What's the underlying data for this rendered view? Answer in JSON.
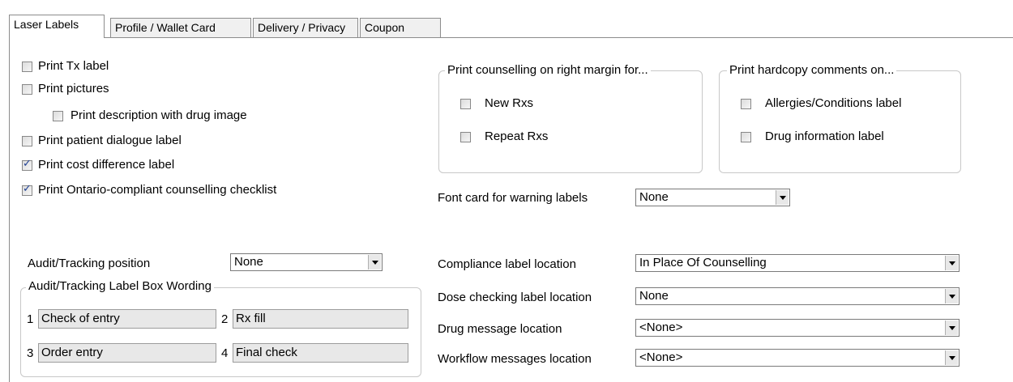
{
  "tabs": [
    {
      "label": "Laser Labels",
      "active": true
    },
    {
      "label": "Profile / Wallet Card"
    },
    {
      "label": "Delivery / Privacy"
    },
    {
      "label": "Coupon"
    }
  ],
  "left_options": [
    {
      "label": "Print Tx label",
      "checked": false
    },
    {
      "label": "Print pictures",
      "checked": false
    },
    {
      "label": "Print description with drug image",
      "checked": false
    },
    {
      "label": "Print patient dialogue label",
      "checked": false
    },
    {
      "label": "Print cost difference label",
      "checked": true
    },
    {
      "label": "Print Ontario-compliant counselling checklist",
      "checked": true
    }
  ],
  "counselling_group": {
    "title": "Print counselling on right margin for...",
    "options": [
      {
        "label": "New Rxs",
        "checked": false
      },
      {
        "label": "Repeat Rxs",
        "checked": false
      }
    ]
  },
  "hardcopy_group": {
    "title": "Print hardcopy comments on...",
    "options": [
      {
        "label": "Allergies/Conditions label",
        "checked": false
      },
      {
        "label": "Drug information label",
        "checked": false
      }
    ]
  },
  "font_card": {
    "label": "Font card for warning labels",
    "value": "None"
  },
  "audit_position": {
    "label": "Audit/Tracking position",
    "value": "None"
  },
  "audit_box": {
    "title": "Audit/Tracking Label Box Wording",
    "fields": [
      {
        "num": "1",
        "value": "Check of entry"
      },
      {
        "num": "2",
        "value": "Rx fill"
      },
      {
        "num": "3",
        "value": "Order entry"
      },
      {
        "num": "4",
        "value": "Final check"
      }
    ]
  },
  "locations": [
    {
      "label": "Compliance label location",
      "value": "In Place Of Counselling"
    },
    {
      "label": "Dose checking label location",
      "value": "None"
    },
    {
      "label": "Drug message location",
      "value": "<None>"
    },
    {
      "label": "Workflow messages location",
      "value": "<None>"
    }
  ]
}
